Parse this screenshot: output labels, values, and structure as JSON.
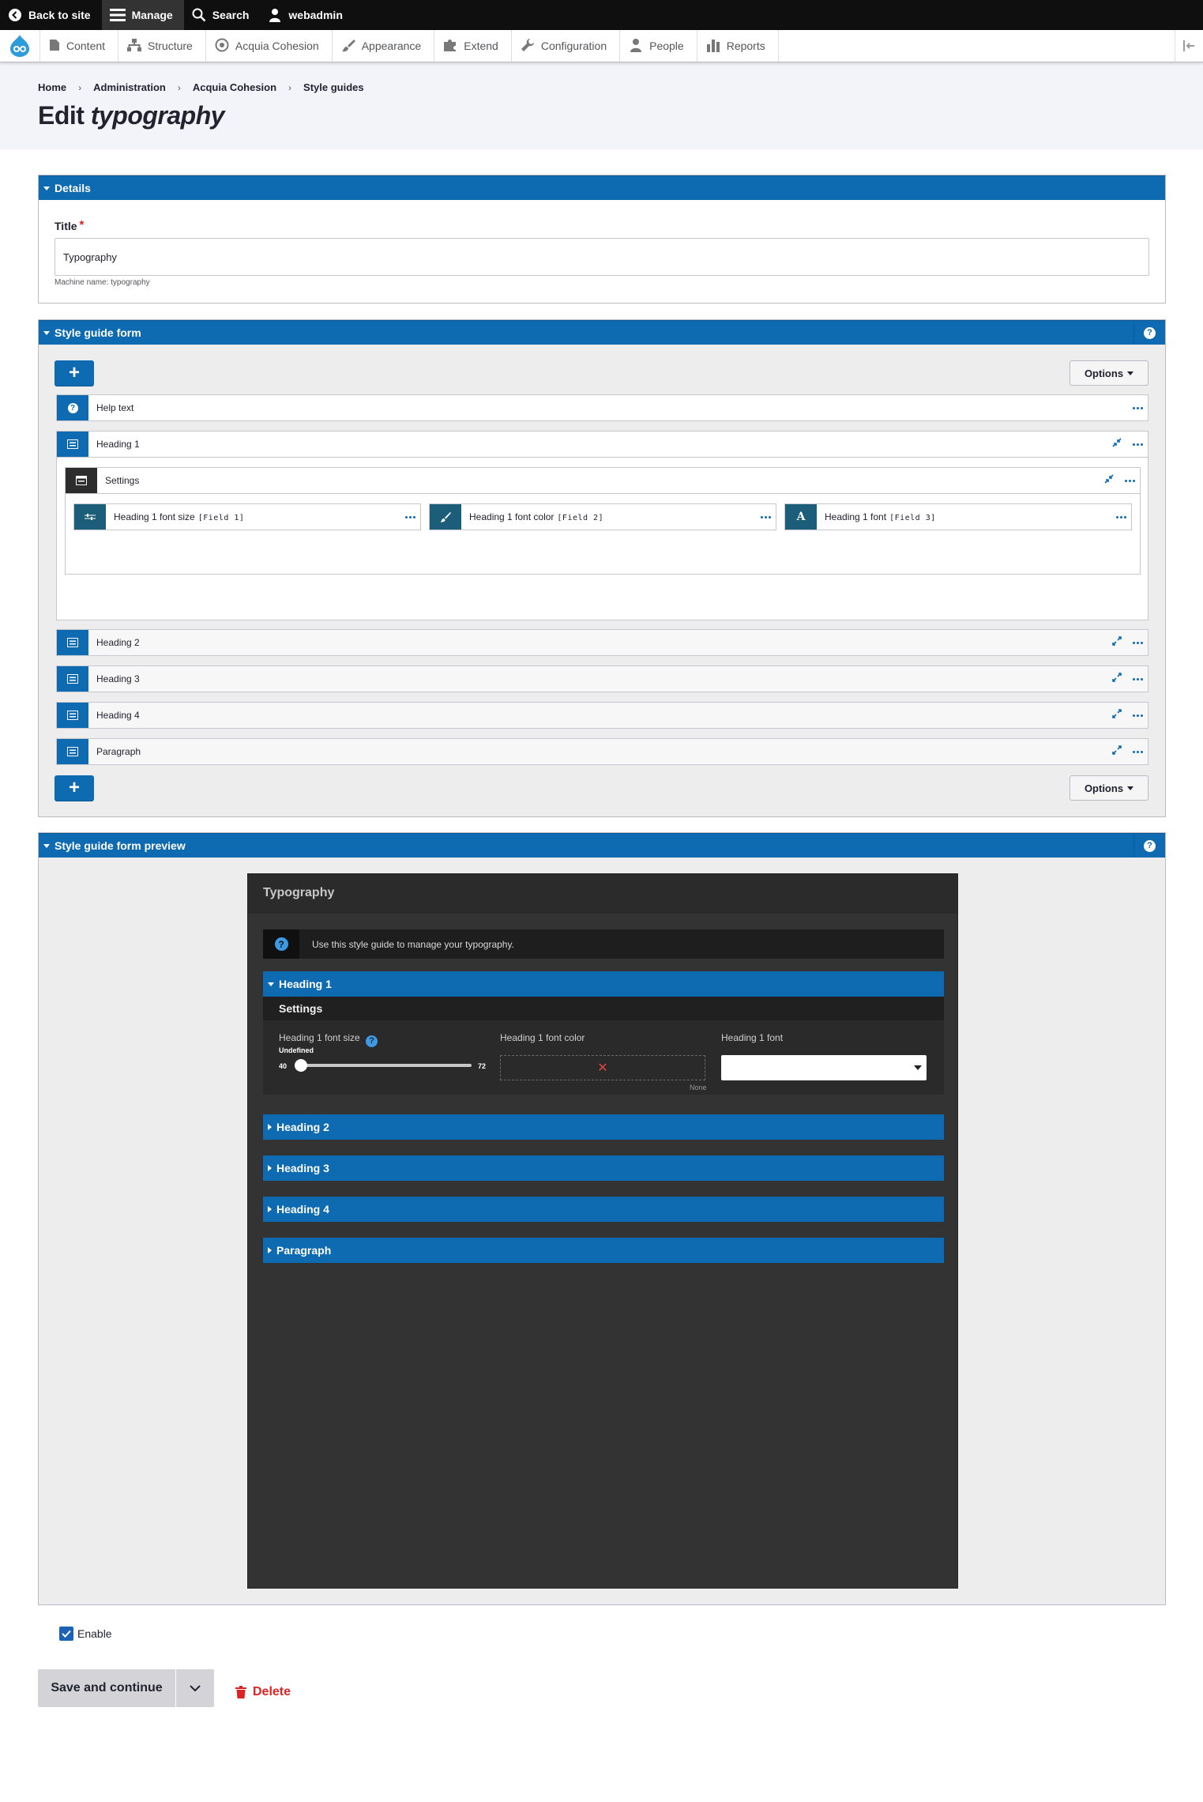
{
  "toolbar": {
    "back_to_site": "Back to site",
    "manage": "Manage",
    "search": "Search",
    "user": "webadmin"
  },
  "tray": {
    "items": [
      "Content",
      "Structure",
      "Acquia Cohesion",
      "Appearance",
      "Extend",
      "Configuration",
      "People",
      "Reports"
    ],
    "icons": [
      "content-icon",
      "structure-icon",
      "cohesion-icon",
      "appearance-icon",
      "extend-icon",
      "configuration-icon",
      "people-icon",
      "reports-icon"
    ]
  },
  "breadcrumb": [
    "Home",
    "Administration",
    "Acquia Cohesion",
    "Style guides"
  ],
  "page_title": {
    "prefix": "Edit",
    "emphasis": "typography"
  },
  "details": {
    "heading": "Details",
    "title_label": "Title",
    "required_mark": "*",
    "title_value": "Typography",
    "machine_name": "Machine name: typography"
  },
  "form_builder": {
    "heading": "Style guide form",
    "help": "?",
    "add_label": "+",
    "options_label": "Options",
    "rows": {
      "help_text": "Help text",
      "heading1": "Heading 1",
      "settings": "Settings",
      "heading2": "Heading 2",
      "heading3": "Heading 3",
      "heading4": "Heading 4",
      "paragraph": "Paragraph"
    },
    "fields": [
      {
        "label": "Heading 1 font size",
        "token": "[Field 1]",
        "icon": "slider-icon"
      },
      {
        "label": "Heading 1 font color",
        "token": "[Field 2]",
        "icon": "brush-icon"
      },
      {
        "label": "Heading 1 font",
        "token": "[Field 3]",
        "icon": "font-icon"
      }
    ]
  },
  "preview": {
    "heading": "Style guide form preview",
    "help": "?",
    "title": "Typography",
    "help_text": "Use this style guide to manage your typography.",
    "accordions": {
      "heading1": "Heading 1",
      "heading2": "Heading 2",
      "heading3": "Heading 3",
      "heading4": "Heading 4",
      "paragraph": "Paragraph"
    },
    "settings": "Settings",
    "font_size_label": "Heading 1 font size",
    "font_size_state": "Undefined",
    "slider_min": "40",
    "slider_max": "72",
    "font_color_label": "Heading 1 font color",
    "font_color_none": "None",
    "font_label": "Heading 1 font"
  },
  "footer": {
    "enable_label": "Enable",
    "enable_checked": true,
    "save_label": "Save and continue",
    "delete_label": "Delete"
  },
  "colors": {
    "accent": "#0f6bb1",
    "danger": "#dc2323",
    "toolbar": "#0f0f0f"
  }
}
